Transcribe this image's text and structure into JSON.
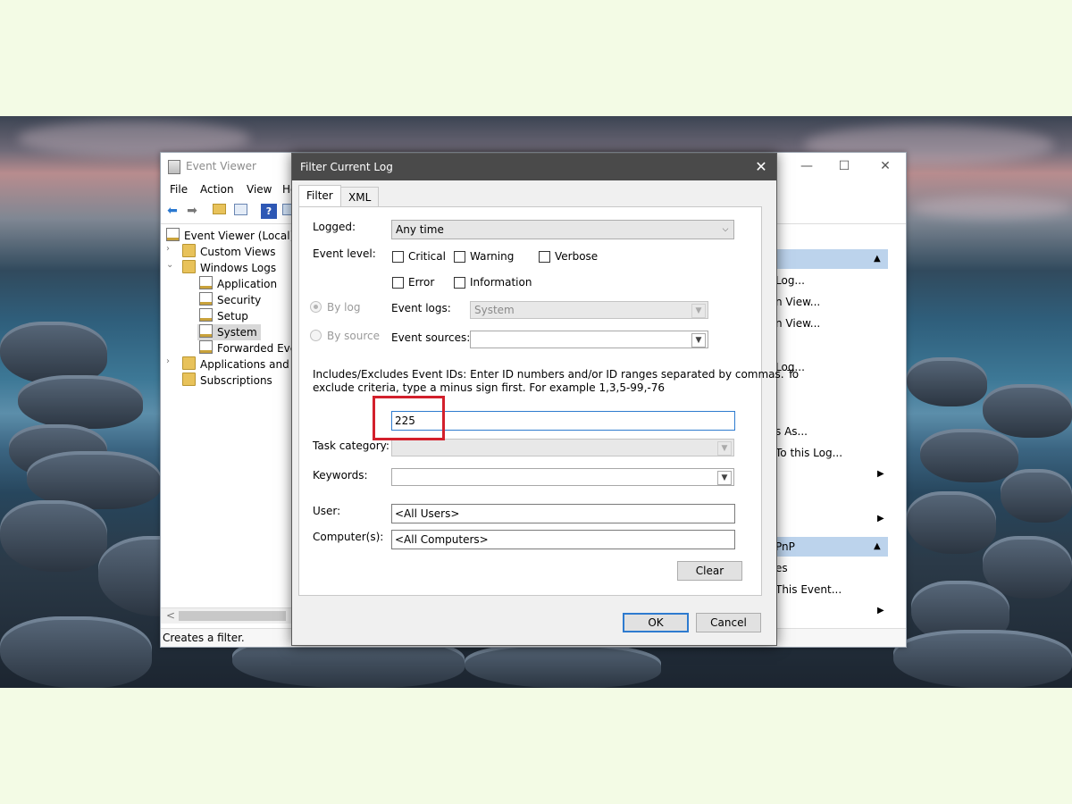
{
  "colors": {
    "highlight": "#d3202c",
    "focus_border": "#2e7bcf",
    "dialog_title_bg": "#4a4a4a",
    "selection": "#d8d8d8",
    "action_header": "#bcd3ec"
  },
  "event_viewer": {
    "title": "Event Viewer",
    "window_controls": {
      "minimize": "—",
      "maximize": "☐",
      "close": "✕"
    },
    "menu": [
      "File",
      "Action",
      "View",
      "He"
    ],
    "toolbar_icons": [
      "back-arrow-icon",
      "forward-arrow-icon",
      "folder-up-icon",
      "console-tree-icon",
      "help-icon",
      "view-icon"
    ],
    "tree": [
      {
        "label": "Event Viewer (Local)",
        "icon": "event-viewer-icon"
      },
      {
        "label": "Custom Views",
        "icon": "folder-icon",
        "arrow": "›"
      },
      {
        "label": "Windows Logs",
        "icon": "folder-icon",
        "arrow": "⌄"
      },
      {
        "label": "Application",
        "icon": "log-icon"
      },
      {
        "label": "Security",
        "icon": "log-icon"
      },
      {
        "label": "Setup",
        "icon": "log-icon"
      },
      {
        "label": "System",
        "icon": "log-icon",
        "selected": true
      },
      {
        "label": "Forwarded Even",
        "icon": "log-icon"
      },
      {
        "label": "Applications and Se",
        "icon": "folder-icon",
        "arrow": "›"
      },
      {
        "label": "Subscriptions",
        "icon": "subscriptions-icon"
      }
    ],
    "scroll_left": "<",
    "status": "Creates a filter.",
    "actions": {
      "header1_arrow": "▲",
      "items": [
        "Log...",
        "n View...",
        "n View...",
        "Log...",
        "s As...",
        "To this Log..."
      ],
      "sub_arrow": "▶",
      "header2": "PnP",
      "header2_arrow": "▲",
      "items2": [
        "es",
        "This Event..."
      ]
    }
  },
  "dialog": {
    "title": "Filter Current Log",
    "close": "✕",
    "tabs": [
      "Filter",
      "XML"
    ],
    "logged": {
      "label": "Logged:",
      "value": "Any time"
    },
    "event_level": {
      "label": "Event level:",
      "options": [
        {
          "label": "Critical",
          "checked": false
        },
        {
          "label": "Warning",
          "checked": false
        },
        {
          "label": "Verbose",
          "checked": false
        },
        {
          "label": "Error",
          "checked": false
        },
        {
          "label": "Information",
          "checked": false
        }
      ]
    },
    "by_log": {
      "label": "By log",
      "selected": true
    },
    "by_source": {
      "label": "By source",
      "selected": false
    },
    "event_logs": {
      "label": "Event logs:",
      "value": "System"
    },
    "event_sources": {
      "label": "Event sources:",
      "value": ""
    },
    "event_ids_help_line1": "Includes/Excludes Event IDs: Enter ID numbers and/or ID ranges separated by commas. To",
    "event_ids_help_line2": "exclude criteria, type a minus sign first. For example 1,3,5-99,-76",
    "event_ids_value": "225",
    "task_category": {
      "label": "Task category:",
      "value": ""
    },
    "keywords": {
      "label": "Keywords:",
      "value": ""
    },
    "user": {
      "label": "User:",
      "value": "<All Users>"
    },
    "computer": {
      "label": "Computer(s):",
      "value": "<All Computers>"
    },
    "clear_button": "Clear",
    "ok_button": "OK",
    "cancel_button": "Cancel",
    "dropdown_arrow": "▼"
  }
}
